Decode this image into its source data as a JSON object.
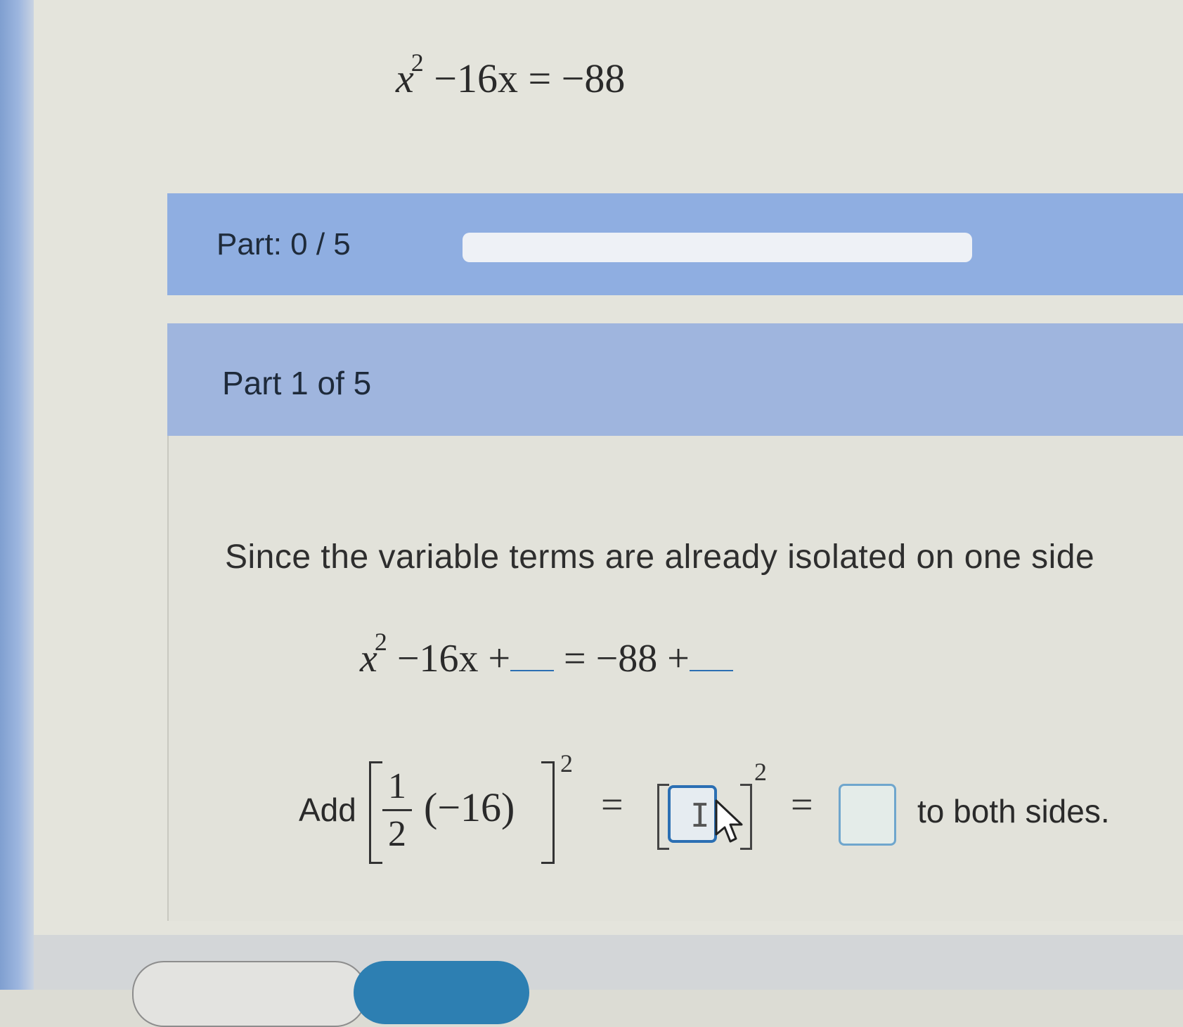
{
  "problem": {
    "equation_lhs_var": "x",
    "equation_lhs_exp": "2",
    "equation_rest": "−16x = −88"
  },
  "progress": {
    "label": "Part: 0 / 5",
    "completed_fraction": 0
  },
  "section": {
    "title": "Part 1 of 5",
    "instruction": "Since the variable terms are already isolated on one side"
  },
  "equation2": {
    "var": "x",
    "exp": "2",
    "middle": "−16x +",
    "rhs": "= −88 +"
  },
  "add_step": {
    "label": "Add",
    "frac_num": "1",
    "frac_den": "2",
    "paren": "(−16)",
    "exponent": "2",
    "equals": "=",
    "inner_exponent": "2",
    "tail": "to both sides."
  },
  "colors": {
    "part_bar": "#8faee1",
    "section_header": "#9fb5de",
    "input_border": "#2b6fb3",
    "primary_button": "#2d7fb2"
  }
}
